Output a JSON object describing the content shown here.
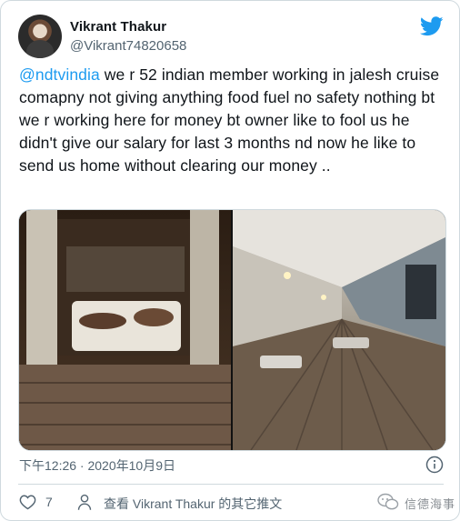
{
  "author": {
    "name": "Vikrant Thakur",
    "handle": "@Vikrant74820658"
  },
  "tweet": {
    "mention": "@ndtvindia",
    "body": " we r 52 indian member working in jalesh cruise comapny not giving anything food fuel no safety nothing bt we r working here for money bt owner like to fool us he didn't give our salary for last 3 months nd now he like to send us home without clearing our money .."
  },
  "timestamp": "下午12:26 · 2020年10月9日",
  "actions": {
    "like_count": "7",
    "more_from_author": "查看 Vikrant Thakur 的其它推文"
  },
  "watermark": "信德海事",
  "colors": {
    "brand_blue": "#1d9bf0",
    "secondary_text": "#536471",
    "border": "#cfd9de"
  },
  "icons": [
    "twitter-bird-icon",
    "info-icon",
    "heart-icon",
    "person-icon",
    "wechat-watermark-icon"
  ]
}
